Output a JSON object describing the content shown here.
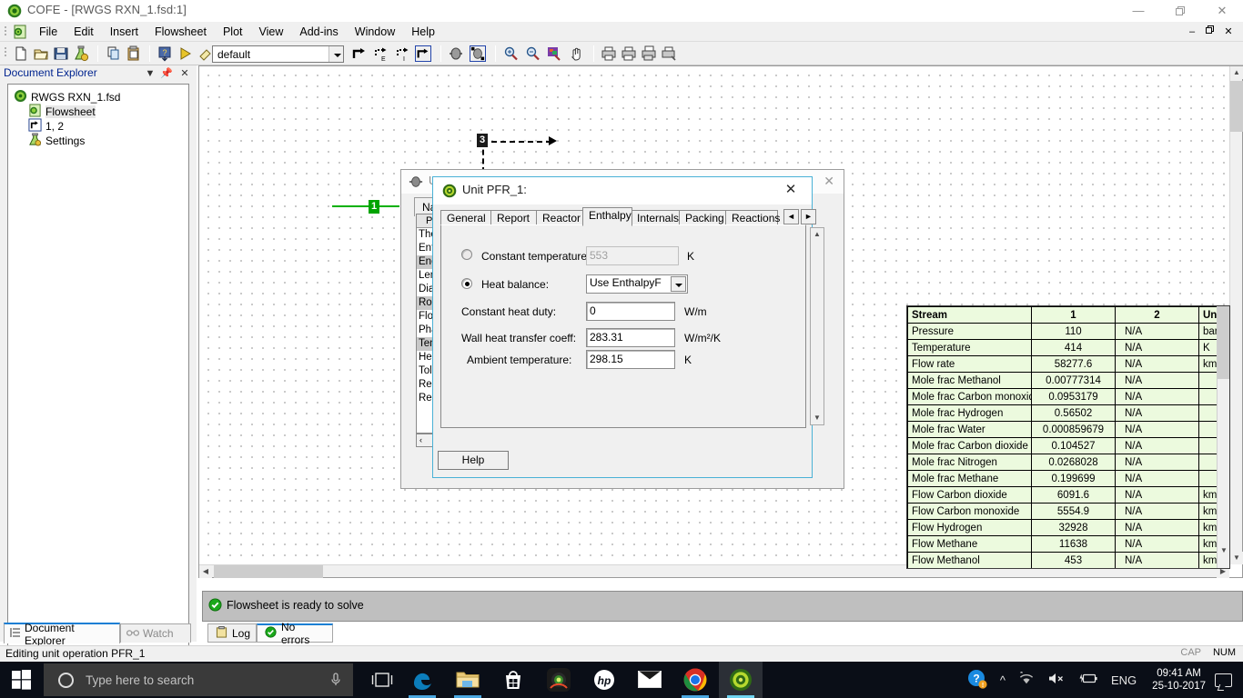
{
  "window": {
    "title": "COFE - [RWGS RXN_1.fsd:1]",
    "app_icon": "cofe-logo-icon",
    "minimize": "—",
    "maximize": "❐",
    "close": "✕",
    "mdi_minimize": "–",
    "mdi_restore": "❐",
    "mdi_close": "✕"
  },
  "menu": {
    "items": [
      "File",
      "Edit",
      "Insert",
      "Flowsheet",
      "Plot",
      "View",
      "Add-ins",
      "Window",
      "Help"
    ]
  },
  "toolbar": {
    "icons": [
      "new-document-icon",
      "open-folder-icon",
      "save-disk-icon",
      "thermo-flask-icon",
      "copy-icon",
      "paste-icon",
      "check-validate-icon",
      "run-play-icon",
      "eraser-icon"
    ],
    "style_combo_value": "default",
    "icons2": [
      "stream-connect-icon",
      "export-stream-icon",
      "import-stream-icon",
      "insert-stream-icon",
      "unit-op-icon",
      "unit-op-selected-icon",
      "zoom-in-icon",
      "zoom-out-icon",
      "zoom-fit-icon",
      "pan-hand-icon",
      "print-icon",
      "print-preview-icon",
      "print-setup-icon",
      "print-flowsheet-icon"
    ]
  },
  "document_explorer": {
    "title": "Document Explorer",
    "header_buttons": [
      "dropdown-icon",
      "pin-icon",
      "close-icon"
    ],
    "tree": [
      {
        "label": "RWGS RXN_1.fsd",
        "icon": "cofe-file-icon",
        "indent": 0,
        "selected": false
      },
      {
        "label": "Flowsheet",
        "icon": "flowsheet-icon",
        "indent": 1,
        "selected": true
      },
      {
        "label": "1, 2",
        "icon": "streams-icon",
        "indent": 1,
        "selected": false
      },
      {
        "label": "Settings",
        "icon": "settings-flask-icon",
        "indent": 1,
        "selected": false
      }
    ],
    "tabs": [
      {
        "label": "Document Explorer",
        "icon": "tree-list-icon",
        "active": true
      },
      {
        "label": "Watch",
        "icon": "binoculars-icon",
        "active": false
      }
    ]
  },
  "flowsheet": {
    "stream_labels": [
      {
        "text": "1",
        "color": "#00a400"
      },
      {
        "text": "3",
        "color": "#1a1a1a"
      }
    ]
  },
  "stream_table": {
    "columns": [
      "Stream",
      "1",
      "2",
      "Unit"
    ],
    "rows": [
      {
        "name": "Pressure",
        "s1": "110",
        "s2": "N/A",
        "unit": "bar"
      },
      {
        "name": "Temperature",
        "s1": "414",
        "s2": "N/A",
        "unit": "K"
      },
      {
        "name": "Flow rate",
        "s1": "58277.6",
        "s2": "N/A",
        "unit": "kmol"
      },
      {
        "name": "Mole frac Methanol",
        "s1": "0.00777314",
        "s2": "N/A",
        "unit": ""
      },
      {
        "name": "Mole frac Carbon monoxide",
        "s1": "0.0953179",
        "s2": "N/A",
        "unit": ""
      },
      {
        "name": "Mole frac Hydrogen",
        "s1": "0.56502",
        "s2": "N/A",
        "unit": ""
      },
      {
        "name": "Mole frac Water",
        "s1": "0.000859679",
        "s2": "N/A",
        "unit": ""
      },
      {
        "name": "Mole frac Carbon dioxide",
        "s1": "0.104527",
        "s2": "N/A",
        "unit": ""
      },
      {
        "name": "Mole frac Nitrogen",
        "s1": "0.0268028",
        "s2": "N/A",
        "unit": ""
      },
      {
        "name": "Mole frac Methane",
        "s1": "0.199699",
        "s2": "N/A",
        "unit": ""
      },
      {
        "name": "Flow Carbon dioxide",
        "s1": "6091.6",
        "s2": "N/A",
        "unit": "kmol"
      },
      {
        "name": "Flow Carbon monoxide",
        "s1": "5554.9",
        "s2": "N/A",
        "unit": "kmol"
      },
      {
        "name": "Flow Hydrogen",
        "s1": "32928",
        "s2": "N/A",
        "unit": "kmol"
      },
      {
        "name": "Flow Methane",
        "s1": "11638",
        "s2": "N/A",
        "unit": "kmol"
      },
      {
        "name": "Flow Methanol",
        "s1": "453",
        "s2": "N/A",
        "unit": "kmol"
      }
    ]
  },
  "background_dialog": {
    "title": "U",
    "icon": "unit-op-icon",
    "close": "✕",
    "tab_label": "Nam",
    "list_header": "Pa",
    "list_rows": [
      {
        "text": "The",
        "highlight": false
      },
      {
        "text": "Ent",
        "highlight": false
      },
      {
        "text": "Ene",
        "highlight": true
      },
      {
        "text": "Len",
        "highlight": false
      },
      {
        "text": "Dia",
        "highlight": false
      },
      {
        "text": "Rou",
        "highlight": true
      },
      {
        "text": "Flo",
        "highlight": false
      },
      {
        "text": "Pha",
        "highlight": false
      },
      {
        "text": "Tem",
        "highlight": true
      },
      {
        "text": "He",
        "highlight": false
      },
      {
        "text": "Tol",
        "highlight": false
      },
      {
        "text": "Rep",
        "highlight": false
      },
      {
        "text": "Re",
        "highlight": false
      }
    ],
    "scroll_left": "‹"
  },
  "unit_dialog": {
    "title": "Unit PFR_1:",
    "icon": "cofe-logo-icon",
    "close": "✕",
    "tabs": [
      {
        "label": "General",
        "active": false
      },
      {
        "label": "Report",
        "active": false
      },
      {
        "label": "Reactor",
        "active": false
      },
      {
        "label": "Enthalpy",
        "active": true
      },
      {
        "label": "Internals",
        "active": false
      },
      {
        "label": "Packing",
        "active": false
      },
      {
        "label": "Reactions",
        "active": false
      }
    ],
    "tab_nav_prev": "◄",
    "tab_nav_next": "►",
    "fields": [
      {
        "kind": "radio",
        "selected": false,
        "label": "Constant temperature:",
        "value": "553",
        "unit": "K",
        "disabled": true
      },
      {
        "kind": "radio",
        "selected": true,
        "label": "Heat balance:",
        "value": "Use EnthalpyF",
        "unit": "",
        "disabled": false
      },
      {
        "kind": "text",
        "label": "Constant heat duty:",
        "value": "0",
        "unit": "W/m",
        "disabled": false
      },
      {
        "kind": "text",
        "label": "Wall heat transfer coeff:",
        "value": "283.31",
        "unit": "W/m²/K",
        "disabled": false
      },
      {
        "kind": "text",
        "label": "Ambient temperature:",
        "value": "298.15",
        "unit": "K",
        "disabled": false
      }
    ],
    "help_label": "Help"
  },
  "message_pane": {
    "icon": "green-check-icon",
    "text": "Flowsheet is ready to solve",
    "tabs": [
      {
        "label": "Log",
        "icon": "clipboard-icon",
        "active": false
      },
      {
        "label": "No errors",
        "icon": "green-check-icon",
        "active": true
      }
    ]
  },
  "status_bar": {
    "text": "Editing unit operation PFR_1",
    "cap": "CAP",
    "num": "NUM"
  },
  "taskbar": {
    "start_icon": "windows-start-icon",
    "search_placeholder": "Type here to search",
    "cortana_icon": "cortana-circle-icon",
    "mic_icon": "microphone-icon",
    "taskview_icon": "task-view-icon",
    "apps": [
      {
        "icon": "edge-browser-icon",
        "active": false,
        "running": true
      },
      {
        "icon": "file-explorer-icon",
        "active": false,
        "running": true
      },
      {
        "icon": "microsoft-store-icon",
        "active": false,
        "running": false
      },
      {
        "icon": "webcam-app-icon",
        "active": false,
        "running": false
      },
      {
        "icon": "hp-logo-icon",
        "active": false,
        "running": false
      },
      {
        "icon": "mail-icon",
        "active": false,
        "running": false
      },
      {
        "icon": "chrome-browser-icon",
        "active": false,
        "running": true
      },
      {
        "icon": "cofe-app-icon",
        "active": true,
        "running": true
      }
    ],
    "tray": {
      "help_icon": "help-question-icon",
      "chevron_icon": "show-hidden-icons-chevron",
      "wifi_icon": "wifi-icon",
      "volume_icon": "volume-muted-icon",
      "battery_icon": "battery-charging-icon",
      "language": "ENG",
      "time": "09:41 AM",
      "date": "25-10-2017",
      "action_center_icon": "action-center-icon"
    }
  }
}
